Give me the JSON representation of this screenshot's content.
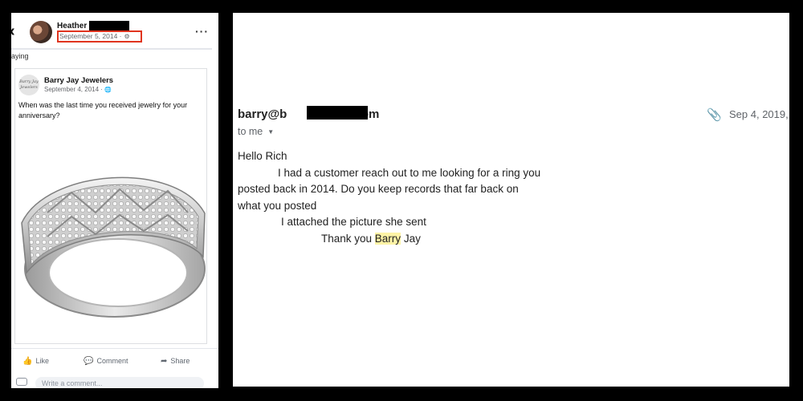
{
  "facebook_post": {
    "back_glyph": "‹",
    "author_name": "Heather",
    "post_date": "September 5, 2014 ·",
    "privacy_icon": "gear-icon",
    "more_glyph": "···",
    "truncated_text": "aying",
    "shared_post": {
      "logo_text": "Barry Jay Jewelers",
      "page_name": "Barry Jay Jewelers",
      "date": "September 4, 2014 · ",
      "globe_glyph": "🌐",
      "text": "When was the last time you received jewelry for your anniversary?"
    },
    "actions": {
      "like": "Like",
      "comment": "Comment",
      "share": "Share"
    },
    "composer_placeholder": "Write a comment..."
  },
  "email": {
    "sender_prefix": "barry@b",
    "sender_suffix": ".com",
    "date": "Sep 4, 2019,",
    "recipient": "to me",
    "greeting": "Hello Rich",
    "line1": "I had a customer reach out to me looking for a ring you",
    "line2": "posted back in 2014.  Do you keep records that far back on",
    "line3": "what you posted",
    "line4": "I attached the picture she sent",
    "signoff_prefix": "Thank you ",
    "signoff_name": "Barry",
    "signoff_suffix": " Jay"
  },
  "colors": {
    "highlight_box": "#e0341f",
    "name_highlight": "#fdf3a6",
    "redaction": "#000000"
  }
}
